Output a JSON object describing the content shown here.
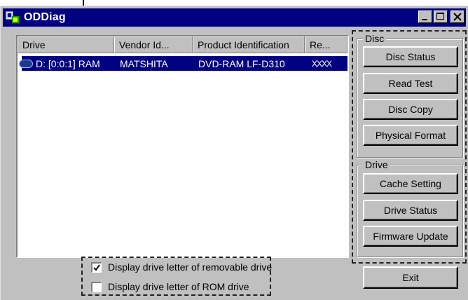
{
  "window": {
    "title": "ODDiag",
    "minimize_icon": "minimize-icon",
    "maximize_icon": "maximize-icon",
    "close_icon": "close-icon"
  },
  "drive_list": {
    "columns": [
      "Drive",
      "Vendor Id...",
      "Product Identification",
      "Re..."
    ],
    "rows": [
      {
        "icon": "drive-icon",
        "drive": "D: [0:0:1] RAM",
        "vendor": "MATSHITA",
        "product": "DVD-RAM LF-D310",
        "revision": "XXXX"
      }
    ]
  },
  "disc_group": {
    "label": "Disc",
    "buttons": [
      "Disc Status",
      "Read Test",
      "Disc Copy",
      "Physical Format"
    ]
  },
  "drive_group": {
    "label": "Drive",
    "buttons": [
      "Cache Setting",
      "Drive Status",
      "Firmware Update"
    ]
  },
  "options": [
    {
      "label": "Display drive letter of removable drive",
      "checked": true
    },
    {
      "label": "Display drive letter of ROM drive",
      "checked": false
    }
  ],
  "exit_label": "Exit"
}
